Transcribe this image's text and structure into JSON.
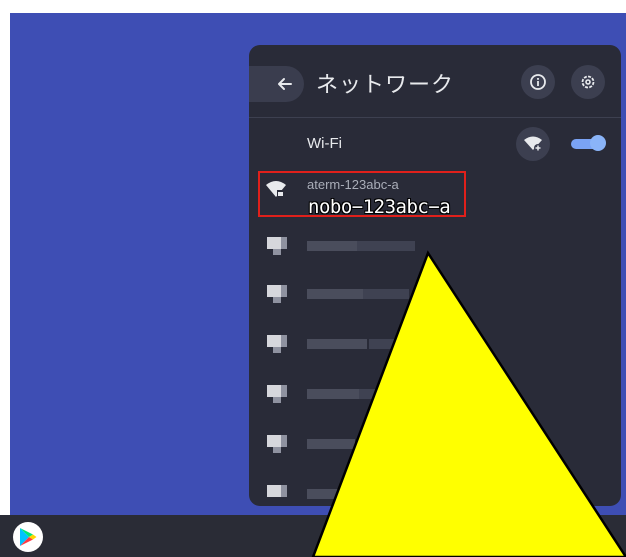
{
  "panel": {
    "title": "ネットワーク",
    "wifi_label": "Wi-Fi",
    "wifi_enabled": true,
    "networks": [
      {
        "name": "aterm-123abc-a",
        "secured": true,
        "highlighted": true
      },
      {
        "name": "",
        "blurred": true
      },
      {
        "name": "",
        "blurred": true
      },
      {
        "name": "",
        "blurred": true
      },
      {
        "name": "",
        "blurred": true
      },
      {
        "name": "",
        "blurred": true
      },
      {
        "name": "",
        "blurred": true
      }
    ]
  },
  "annotation": {
    "text": "nobo−123abc−a",
    "highlight_color": "#e0201b",
    "pointer_color": "#ffff00"
  },
  "colors": {
    "wallpaper": "#3e4eb4",
    "panel_bg": "#292b38",
    "accent": "#8ab4f8"
  },
  "icons": {
    "back": "arrow-left-icon",
    "info": "info-icon",
    "settings": "gear-icon",
    "add_network": "wifi-add-icon",
    "launcher": "play-store-icon"
  }
}
